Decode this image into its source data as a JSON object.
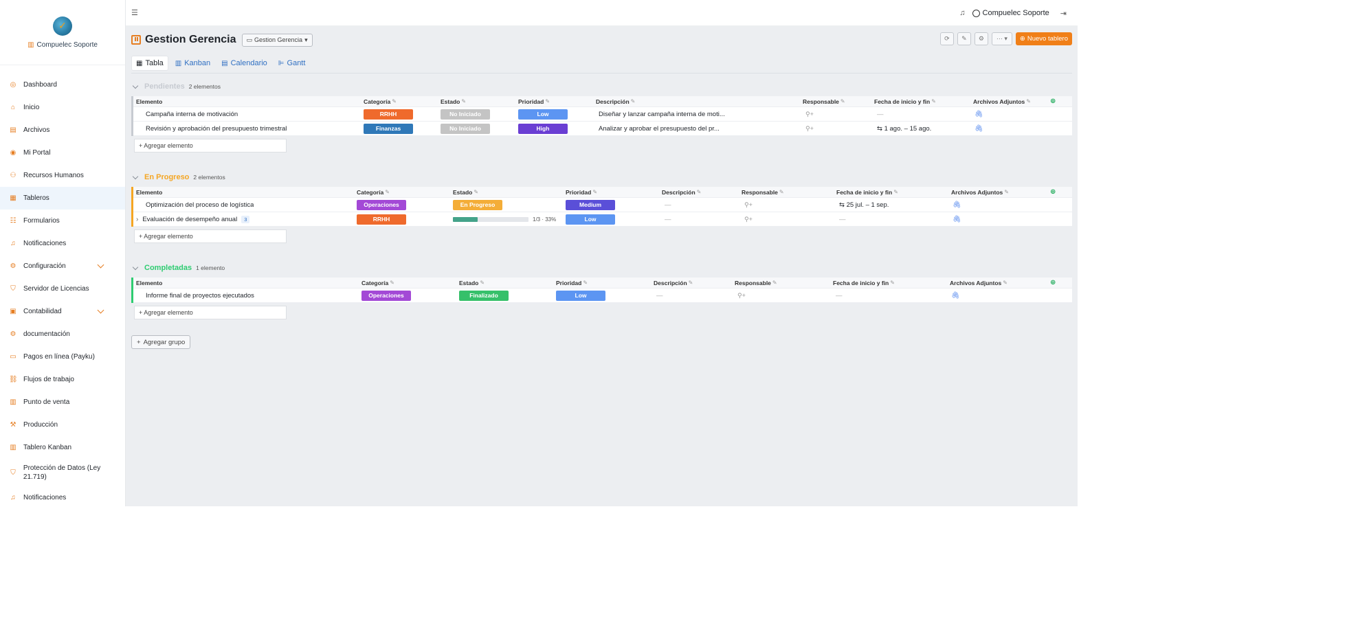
{
  "brand": {
    "name": "Compuelec Soporte"
  },
  "sidebar": {
    "items": [
      {
        "label": "Dashboard",
        "icon": "dashboard-icon",
        "glyph": "◎"
      },
      {
        "label": "Inicio",
        "icon": "home-icon",
        "glyph": "⌂"
      },
      {
        "label": "Archivos",
        "icon": "file-icon",
        "glyph": "▤"
      },
      {
        "label": "Mi Portal",
        "icon": "user-circle-icon",
        "glyph": "◉"
      },
      {
        "label": "Recursos Humanos",
        "icon": "users-icon",
        "glyph": "⚇"
      },
      {
        "label": "Tableros",
        "icon": "table-icon",
        "glyph": "▦",
        "active": true
      },
      {
        "label": "Formularios",
        "icon": "form-icon",
        "glyph": "☷"
      },
      {
        "label": "Notificaciones",
        "icon": "bell-icon",
        "glyph": "♫"
      },
      {
        "label": "Configuración",
        "icon": "gear-icon",
        "glyph": "⚙",
        "expandable": true
      },
      {
        "label": "Servidor de Licencias",
        "icon": "shield-icon",
        "glyph": "⛉"
      },
      {
        "label": "Contabilidad",
        "icon": "calculator-icon",
        "glyph": "▣",
        "expandable": true
      },
      {
        "label": "documentación",
        "icon": "gear-icon",
        "glyph": "⚙"
      },
      {
        "label": "Pagos en línea (Payku)",
        "icon": "credit-card-icon",
        "glyph": "▭"
      },
      {
        "label": "Flujos de trabajo",
        "icon": "workflow-icon",
        "glyph": "⛓"
      },
      {
        "label": "Punto de venta",
        "icon": "pos-icon",
        "glyph": "▥"
      },
      {
        "label": "Producción",
        "icon": "hammer-icon",
        "glyph": "⚒"
      },
      {
        "label": "Tablero Kanban",
        "icon": "kanban-icon",
        "glyph": "▥"
      },
      {
        "label": "Protección de Datos (Ley 21.719)",
        "icon": "shield-icon",
        "glyph": "⛉",
        "tall": true
      },
      {
        "label": "Notificaciones",
        "icon": "bell-icon",
        "glyph": "♫"
      }
    ]
  },
  "topbar": {
    "user": "Compuelec Soporte"
  },
  "header": {
    "title": "Gestion Gerencia",
    "board_select": "Gestion Gerencia",
    "new_board": "Nuevo tablero"
  },
  "tabs": [
    {
      "label": "Tabla",
      "active": true,
      "icon": "table-icon",
      "glyph": "▦"
    },
    {
      "label": "Kanban",
      "icon": "kanban-icon",
      "glyph": "▥"
    },
    {
      "label": "Calendario",
      "icon": "calendar-icon",
      "glyph": "▤"
    },
    {
      "label": "Gantt",
      "icon": "gantt-icon",
      "glyph": "⊫"
    }
  ],
  "groups": [
    {
      "title": "Pendientes",
      "count": "2 elementos",
      "color": "#c7cbd1",
      "columns": [
        "Elemento",
        "Categoría",
        "Estado",
        "Prioridad",
        "Descripción",
        "Responsable",
        "Fecha de inicio y fin",
        "Archivos Adjuntos"
      ],
      "rows": [
        {
          "element": "Campaña interna de motivación",
          "category": "RRHH",
          "category_color": "#ef6a2c",
          "status": "No Iniciado",
          "status_color": "#c4c4c4",
          "priority": "Low",
          "priority_color": "#5c95f2",
          "description": "Diseñar y lanzar campaña interna de moti...",
          "date": "—"
        },
        {
          "element": "Revisión y aprobación del presupuesto trimestral",
          "category": "Finanzas",
          "category_color": "#2f78b8",
          "status": "No Iniciado",
          "status_color": "#c4c4c4",
          "priority": "High",
          "priority_color": "#6a3ed3",
          "description": "Analizar y aprobar el presupuesto del pr...",
          "date": "⇆ 1 ago. – 15 ago."
        }
      ],
      "add_label": "+ Agregar elemento"
    },
    {
      "title": "En Progreso",
      "count": "2 elementos",
      "color": "#f5a623",
      "columns": [
        "Elemento",
        "Categoría",
        "Estado",
        "Prioridad",
        "Descripción",
        "Responsable",
        "Fecha de inicio y fin",
        "Archivos Adjuntos"
      ],
      "rows": [
        {
          "element": "Optimización del proceso de logística",
          "category": "Operaciones",
          "category_color": "#a349d6",
          "status": "En Progreso",
          "status_color": "#f4ad38",
          "priority": "Medium",
          "priority_color": "#5a4fd8",
          "description": "—",
          "date": "⇆ 25 jul. – 1 sep."
        },
        {
          "element": "Evaluación de desempeño anual",
          "category": "RRHH",
          "category_color": "#ef6a2c",
          "subitems": "3",
          "progress": 0.33,
          "progress_text": "1/3 · 33%",
          "priority": "Low",
          "priority_color": "#5c95f2",
          "description": "—",
          "date": "—"
        }
      ],
      "add_label": "+ Agregar elemento"
    },
    {
      "title": "Completadas",
      "count": "1 elemento",
      "color": "#2ecc71",
      "columns": [
        "Elemento",
        "Categoría",
        "Estado",
        "Prioridad",
        "Descripción",
        "Responsable",
        "Fecha de inicio y fin",
        "Archivos Adjuntos"
      ],
      "rows": [
        {
          "element": "Informe final de proyectos ejecutados",
          "category": "Operaciones",
          "category_color": "#a349d6",
          "status": "Finalizado",
          "status_color": "#36c06a",
          "priority": "Low",
          "priority_color": "#5c95f2",
          "description": "—",
          "date": "—"
        }
      ],
      "add_label": "+ Agregar elemento"
    }
  ],
  "add_group": "Agregar grupo"
}
